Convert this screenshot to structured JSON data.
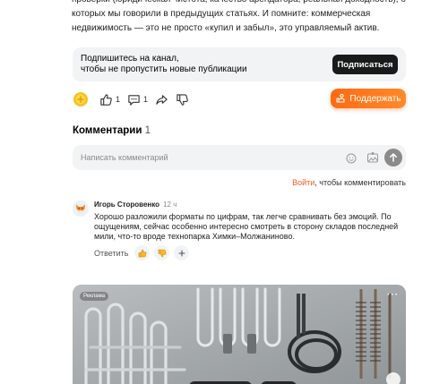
{
  "article": {
    "line1": "проверки (юридическая чистота, качество арендатора, реальная доходность), о",
    "line2": "которых мы говорили в предыдущих статьях. И помните: коммерческая",
    "line3": "недвижимость — это не просто «купил и забыл», это управляемый актив."
  },
  "subscribe": {
    "line1": "Подпишитесь на канал,",
    "line2": "чтобы не пропустить новые публикации",
    "button": "Подписаться"
  },
  "actions": {
    "like_count": "1",
    "comment_count": "1",
    "support_label": "Поддержать",
    "accent_color": "#ff6a13"
  },
  "comments": {
    "title": "Комментарии",
    "count": "1",
    "input_placeholder": "Написать комментарий",
    "login_link": "Войти",
    "login_rest": ", чтобы комментировать"
  },
  "comment": {
    "author": "Игорь Сторовенко",
    "time": "12 ч",
    "line1": "Хорошо разложили форматы по цифрам, так легче сравнивать без эмоций. По",
    "line2": "ощущениям, сейчас особенно интересно смотреть в сторону складов последней",
    "line3": "мили, что-то вроде технопарка Химки–Молжаниново.",
    "reply": "Ответить"
  },
  "ad": {
    "badge": "Реклама",
    "menu": "···"
  },
  "icons": [
    "gold-coin-icon",
    "thumbs-up-icon",
    "comment-icon",
    "share-icon",
    "thumbs-down-icon",
    "support-icon",
    "emoji-icon",
    "image-icon",
    "send-arrow-icon",
    "fox-avatar-icon",
    "like-emoji-icon",
    "dislike-emoji-icon",
    "plus-icon"
  ]
}
